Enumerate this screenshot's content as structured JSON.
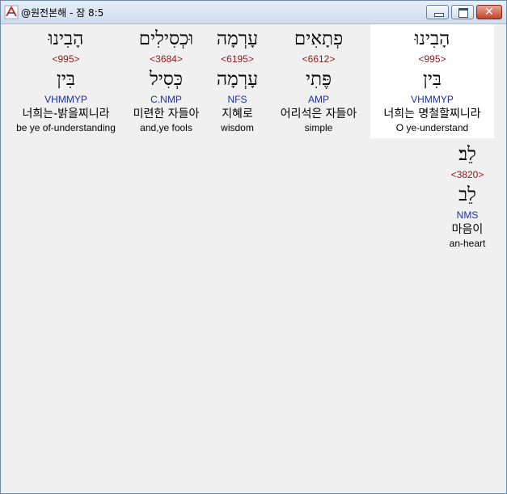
{
  "window": {
    "title": "@원전본해 - 잠 8:5",
    "controls": {
      "minimize": "minimize",
      "maximize": "maximize",
      "close": "✕"
    }
  },
  "words": [
    {
      "surface": "הָבִינוּ",
      "strong": "<995>",
      "lemma": "בִּין",
      "morph": "VHMMYP",
      "korean": "너희는 명철할찌니라",
      "english": "O ye-understand"
    },
    {
      "surface": "פְתָאִים",
      "strong": "<6612>",
      "lemma": "פֶּתִי",
      "morph": "AMP",
      "korean": "어리석은 자들아",
      "english": "simple"
    },
    {
      "surface": "עָרְמָה",
      "strong": "<6195>",
      "lemma": "עָרְמָה",
      "morph": "NFS",
      "korean": "지혜로",
      "english": "wisdom"
    },
    {
      "surface": "וּכְסִילִים",
      "strong": "<3684>",
      "lemma": "כְּסִיל",
      "morph": "C.NMP",
      "korean": "미련한 자들아",
      "english": "and,ye fools"
    },
    {
      "surface": "הָבִינוּ",
      "strong": "<995>",
      "lemma": "בִּין",
      "morph": "VHMMYP",
      "korean": "너희는-밝을찌니라",
      "english": "be ye of-understanding"
    },
    {
      "surface": "לֵב׃",
      "strong": "<3820>",
      "lemma": "לֵב",
      "morph": "NMS",
      "korean": "마음이",
      "english": "an-heart"
    }
  ]
}
